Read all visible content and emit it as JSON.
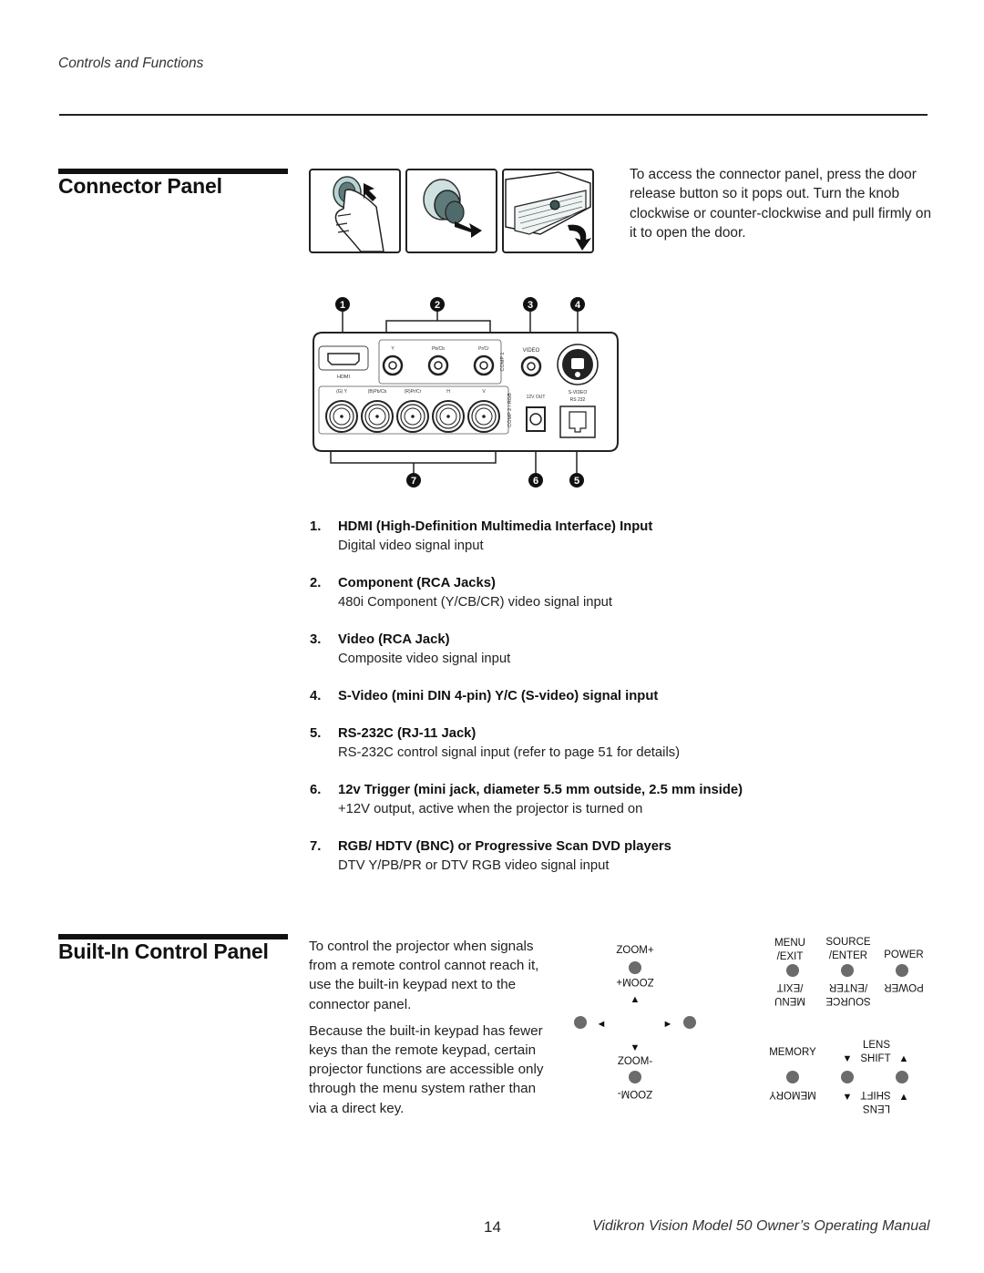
{
  "header": {
    "section_label": "Controls and Functions"
  },
  "connector_panel": {
    "title": "Connector Panel",
    "intro": "To access the connector panel, press the door release button so it pops out. Turn the knob clockwise or counter-clockwise and pull firmly on it to open the door.",
    "steps": [
      "press-door-release-button",
      "turn-and-pull-knob",
      "open-door"
    ],
    "diagram": {
      "callouts": [
        "1",
        "2",
        "3",
        "4",
        "5",
        "6",
        "7"
      ],
      "labels": {
        "hdmi": "HDMI",
        "comp1": "COMP 1",
        "comp1_y": "Y",
        "comp1_pb": "Pb/Cb",
        "comp1_pr": "Pr/Cr",
        "video": "VIDEO",
        "comp2": "COMP 2 / RGB",
        "comp2_g": "(G) Y",
        "comp2_b": "(B)Pb/Cb",
        "comp2_r": "(R)Pr/Cr",
        "comp2_h": "H",
        "comp2_v": "V",
        "svideo": "S-VIDEO",
        "trigger": "12V OUT",
        "rs232": "RS 232"
      }
    },
    "items": [
      {
        "num": "1.",
        "title": "HDMI (High-Definition Multimedia Interface) Input",
        "desc": "Digital video signal input"
      },
      {
        "num": "2.",
        "title": "Component (RCA Jacks)",
        "desc": "480i Component (Y/CB/CR) video signal input"
      },
      {
        "num": "3.",
        "title": "Video (RCA Jack)",
        "desc": "Composite video signal input"
      },
      {
        "num": "4.",
        "title": "S-Video (mini DIN 4-pin) Y/C (S-video) signal input",
        "desc": ""
      },
      {
        "num": "5.",
        "title": "RS-232C (RJ-11 Jack)",
        "desc": "RS-232C control signal input (refer to page 51 for details)"
      },
      {
        "num": "6.",
        "title": "12v Trigger (mini jack, diameter 5.5 mm outside, 2.5 mm inside)",
        "desc": "+12V output, active when the projector is turned on"
      },
      {
        "num": "7.",
        "title": "RGB/ HDTV (BNC) or Progressive Scan DVD players",
        "desc": "DTV Y/PB/PR or DTV RGB video signal input"
      }
    ]
  },
  "builtin_panel": {
    "title": "Built-In Control Panel",
    "paragraphs": [
      "To control the projector when signals from a remote control cannot reach it, use the built-in keypad next to the connector panel.",
      "Because the built-in keypad has fewer keys than the remote keypad, certain projector functions are accessible only through the menu system rather than via a direct key."
    ],
    "keypad": {
      "zoom_plus": "ZOOM+",
      "zoom_minus": "ZOOM-",
      "menu": "MENU",
      "exit": "/EXIT",
      "source": "SOURCE",
      "enter": "/ENTER",
      "power": "POWER",
      "memory": "MEMORY",
      "lens": "LENS",
      "shift": "SHIFT",
      "up_arrow": "▲",
      "down_arrow": "▼",
      "left_arrow": "◄",
      "right_arrow": "►",
      "key_color": "#6b6b6b"
    }
  },
  "footer": {
    "page_number": "14",
    "manual_title": "Vidikron Vision Model 50 Owner’s Operating Manual"
  }
}
